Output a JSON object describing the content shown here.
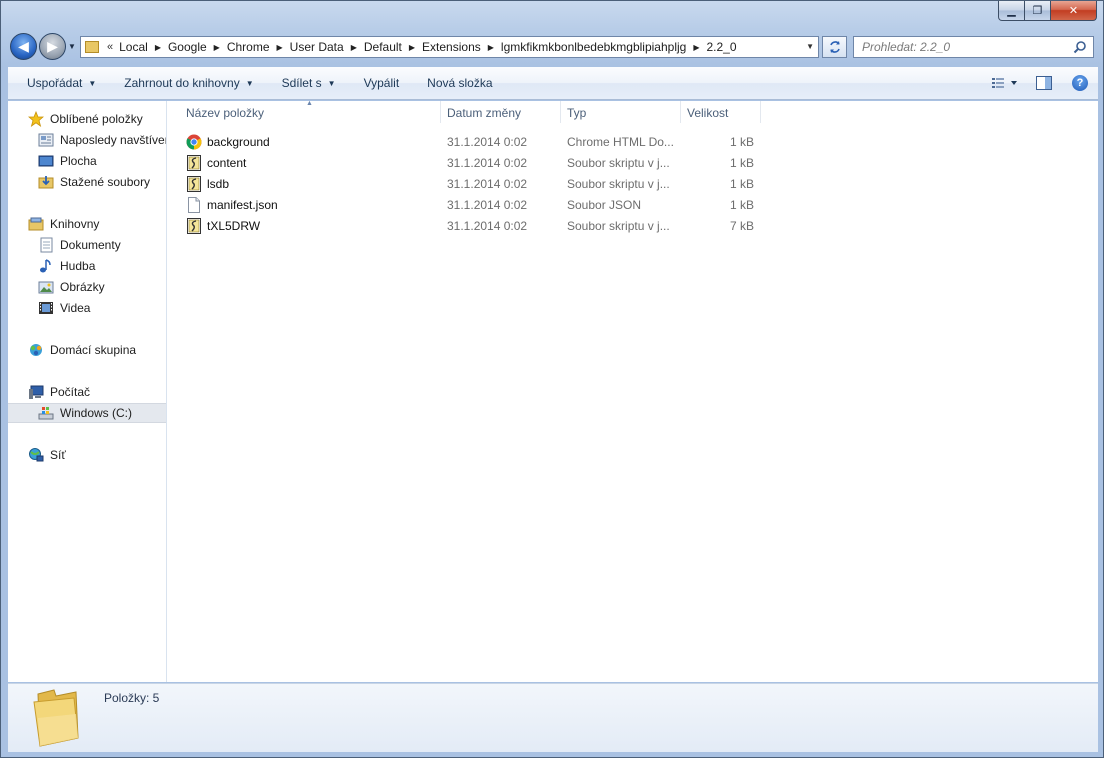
{
  "window": {
    "caption_buttons": {
      "minimize": "▁",
      "maximize": "❐",
      "close": "✕"
    }
  },
  "address": {
    "overflow_chevron": "«",
    "crumbs": [
      "Local",
      "Google",
      "Chrome",
      "User Data",
      "Default",
      "Extensions",
      "lgmkfikmkbonlbedebkmgblipiahpljg",
      "2.2_0"
    ],
    "search_placeholder": "Prohledat: 2.2_0"
  },
  "toolbar": {
    "organize": "Uspořádat",
    "include_library": "Zahrnout do knihovny",
    "share": "Sdílet s",
    "burn": "Vypálit",
    "new_folder": "Nová složka",
    "help": "?"
  },
  "nav": {
    "favorites": "Oblíbené položky",
    "recent": "Naposledy navštívené",
    "desktop": "Plocha",
    "downloads": "Stažené soubory",
    "libraries": "Knihovny",
    "documents": "Dokumenty",
    "music": "Hudba",
    "pictures": "Obrázky",
    "videos": "Videa",
    "homegroup": "Domácí skupina",
    "computer": "Počítač",
    "drive_c": "Windows (C:)",
    "network": "Síť"
  },
  "columns": {
    "name": "Název položky",
    "date": "Datum změny",
    "type": "Typ",
    "size": "Velikost"
  },
  "files": [
    {
      "name": "background",
      "date": "31.1.2014 0:02",
      "type": "Chrome HTML Do...",
      "size": "1 kB",
      "icon": "chrome-icon"
    },
    {
      "name": "content",
      "date": "31.1.2014 0:02",
      "type": "Soubor skriptu v j...",
      "size": "1 kB",
      "icon": "script-file-icon"
    },
    {
      "name": "lsdb",
      "date": "31.1.2014 0:02",
      "type": "Soubor skriptu v j...",
      "size": "1 kB",
      "icon": "script-file-icon"
    },
    {
      "name": "manifest.json",
      "date": "31.1.2014 0:02",
      "type": "Soubor JSON",
      "size": "1 kB",
      "icon": "blank-file-icon"
    },
    {
      "name": "tXL5DRW",
      "date": "31.1.2014 0:02",
      "type": "Soubor skriptu v j...",
      "size": "7 kB",
      "icon": "script-file-icon"
    }
  ],
  "details": {
    "items_label": "Položky: 5"
  }
}
